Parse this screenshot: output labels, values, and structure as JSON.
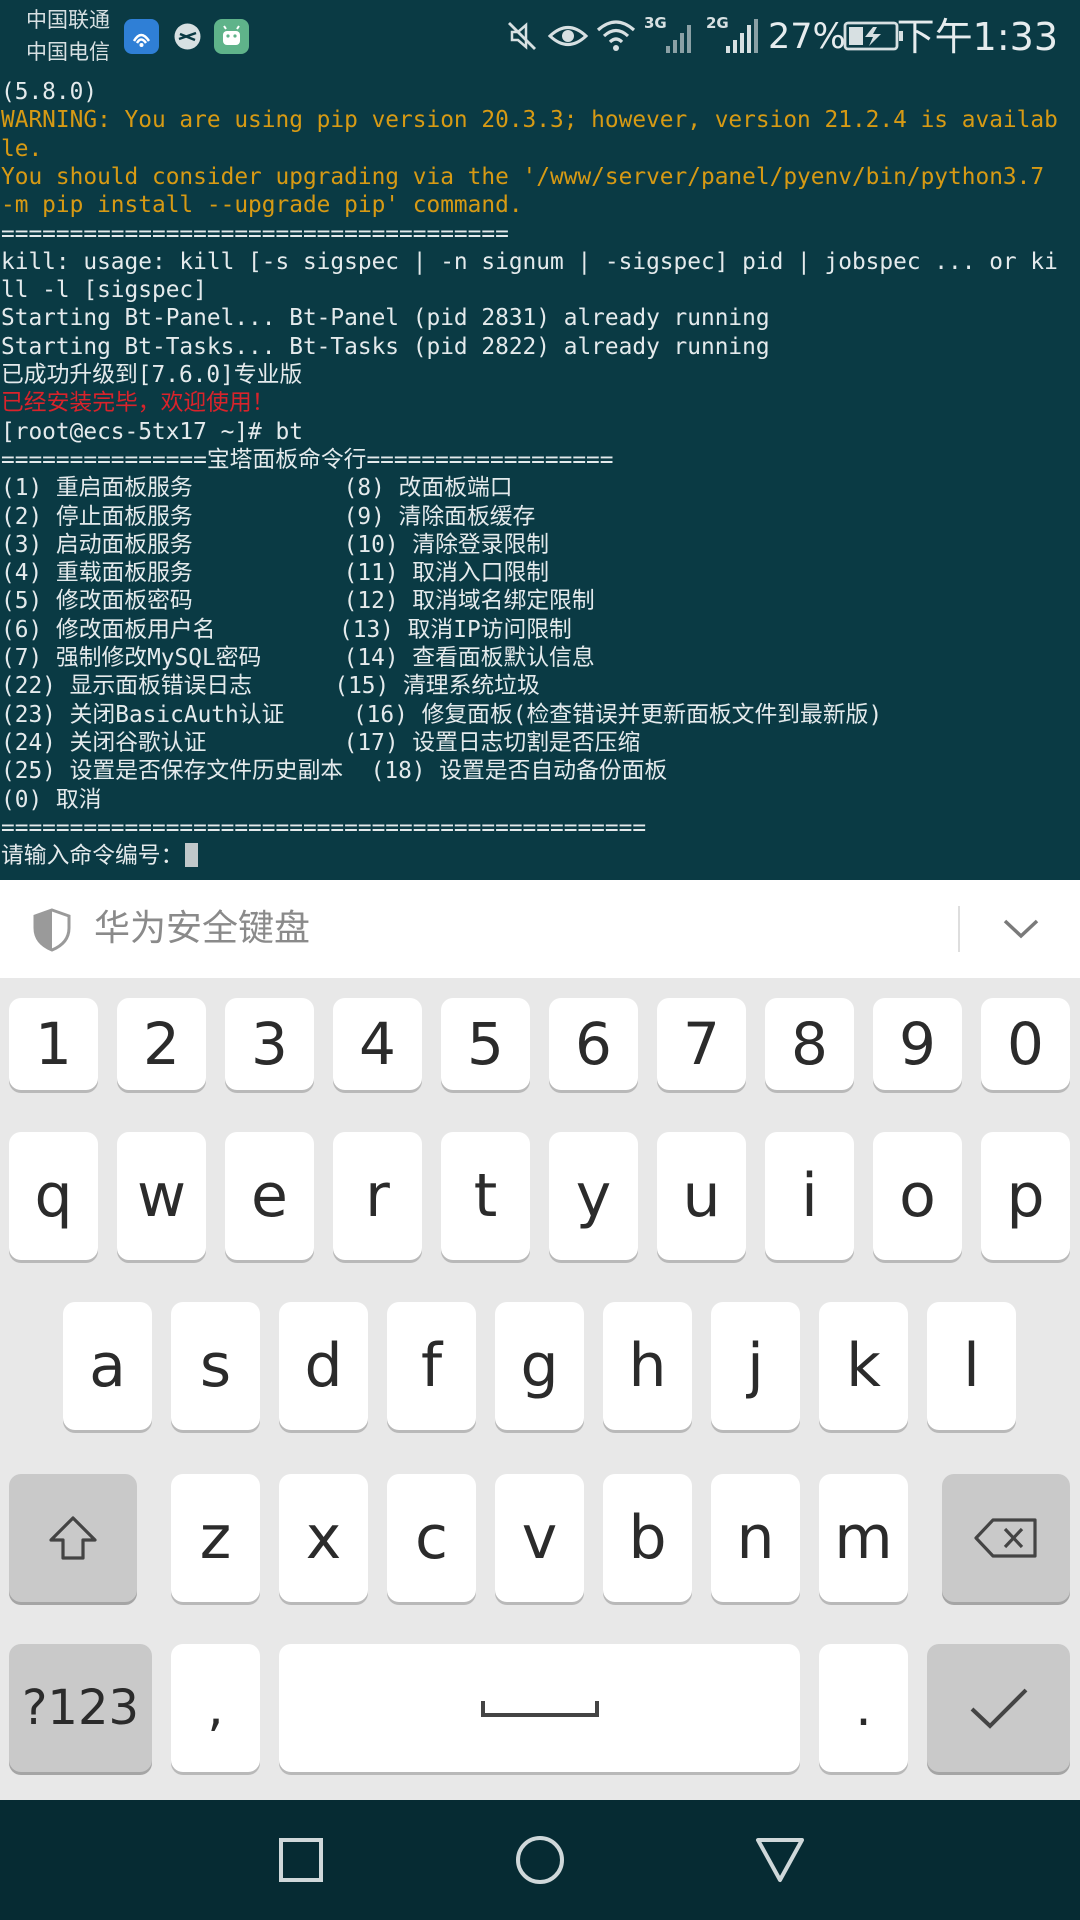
{
  "status_bar": {
    "carrier_1": "中国联通",
    "carrier_2": "中国电信",
    "net_3g": "3G",
    "net_2g": "2G",
    "battery_percent": "27%",
    "time": "下午1:33",
    "icons": [
      "wifi-hotspot-app-icon",
      "cleaner-app-icon",
      "android-app-icon",
      "mute-icon",
      "eye-comfort-icon",
      "wifi-icon",
      "signal-3g-icon",
      "signal-2g-icon",
      "battery-charging-icon"
    ]
  },
  "terminal": {
    "lines": [
      {
        "text": "(5.8.0)",
        "style": "normal"
      },
      {
        "text": "WARNING: You are using pip version 20.3.3; however, version 21.2.4 is availab",
        "style": "warn"
      },
      {
        "text": "le.",
        "style": "warn"
      },
      {
        "text": "You should consider upgrading via the '/www/server/panel/pyenv/bin/python3.7",
        "style": "warn"
      },
      {
        "text": "-m pip install --upgrade pip' command.",
        "style": "warn"
      },
      {
        "text": "=====================================",
        "style": "normal"
      },
      {
        "text": "kill: usage: kill [-s sigspec | -n signum | -sigspec] pid | jobspec ... or ki",
        "style": "normal"
      },
      {
        "text": "ll -l [sigspec]",
        "style": "normal"
      },
      {
        "text": "Starting Bt-Panel... Bt-Panel (pid 2831) already running",
        "style": "normal"
      },
      {
        "text": "Starting Bt-Tasks... Bt-Tasks (pid 2822) already running",
        "style": "normal"
      },
      {
        "text": "已成功升级到[7.6.0]专业版",
        "style": "normal"
      },
      {
        "text": "已经安装完毕，欢迎使用！",
        "style": "red"
      },
      {
        "text": "[root@ecs-5tx17 ~]# bt",
        "style": "normal"
      },
      {
        "text": "===============宝塔面板命令行==================",
        "style": "normal"
      },
      {
        "text": "(1) 重启面板服务           (8) 改面板端口",
        "style": "normal"
      },
      {
        "text": "(2) 停止面板服务           (9) 清除面板缓存",
        "style": "normal"
      },
      {
        "text": "(3) 启动面板服务           (10) 清除登录限制",
        "style": "normal"
      },
      {
        "text": "(4) 重载面板服务           (11) 取消入口限制",
        "style": "normal"
      },
      {
        "text": "(5) 修改面板密码           (12) 取消域名绑定限制",
        "style": "normal"
      },
      {
        "text": "(6) 修改面板用户名         (13) 取消IP访问限制",
        "style": "normal"
      },
      {
        "text": "(7) 强制修改MySQL密码      (14) 查看面板默认信息",
        "style": "normal"
      },
      {
        "text": "(22) 显示面板错误日志      (15) 清理系统垃圾",
        "style": "normal"
      },
      {
        "text": "(23) 关闭BasicAuth认证     (16) 修复面板(检查错误并更新面板文件到最新版)",
        "style": "normal"
      },
      {
        "text": "(24) 关闭谷歌认证          (17) 设置日志切割是否压缩",
        "style": "normal"
      },
      {
        "text": "(25) 设置是否保存文件历史副本  (18) 设置是否自动备份面板",
        "style": "normal"
      },
      {
        "text": "(0) 取消",
        "style": "normal"
      },
      {
        "text": "===============================================",
        "style": "normal"
      },
      {
        "text": "请输入命令编号：",
        "style": "normal",
        "cursor": true
      }
    ]
  },
  "keyboard": {
    "title": "华为安全键盘",
    "row_numbers": [
      "1",
      "2",
      "3",
      "4",
      "5",
      "6",
      "7",
      "8",
      "9",
      "0"
    ],
    "row_top": [
      "q",
      "w",
      "e",
      "r",
      "t",
      "y",
      "u",
      "i",
      "o",
      "p"
    ],
    "row_middle": [
      "a",
      "s",
      "d",
      "f",
      "g",
      "h",
      "j",
      "k",
      "l"
    ],
    "row_bottom": [
      "z",
      "x",
      "c",
      "v",
      "b",
      "n",
      "m"
    ],
    "symbols_label": "?123",
    "comma_label": ",",
    "period_label": "."
  },
  "colors": {
    "terminal_bg": "#0a3a44",
    "warning": "#d79a14",
    "error_red": "#d9232b",
    "key_bg": "#ffffff",
    "key_gray": "#c9c9c9",
    "keyboard_bg": "#e8e8e8"
  }
}
